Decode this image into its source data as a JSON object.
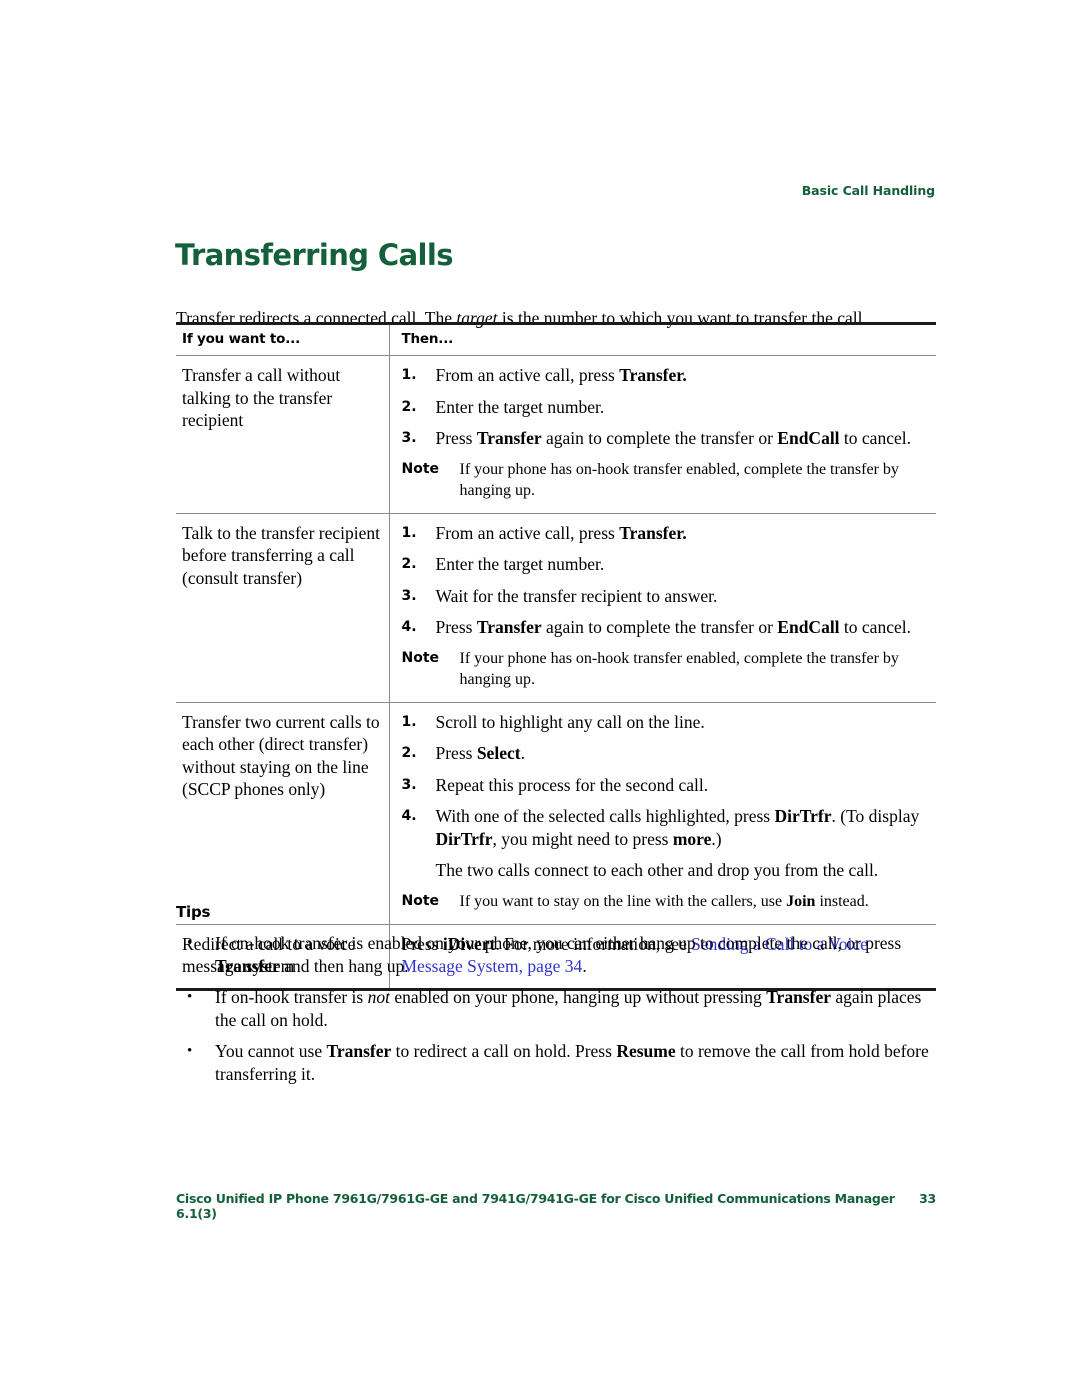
{
  "colors": {
    "heading_green": "#14603a",
    "link_blue": "#3333cc",
    "rule_dark": "#1a1a1a",
    "rule_light": "#8a8a8a"
  },
  "running_header": "Basic Call Handling",
  "page_title": "Transferring Calls",
  "intro": {
    "before_italic": "Transfer redirects a connected call. The ",
    "italic": "target",
    "after_italic": " is the number to which you want to transfer the call."
  },
  "table": {
    "headers": {
      "col1": "If you want to...",
      "col2": "Then..."
    },
    "rows": [
      {
        "label": "Transfer a call without talking to the transfer recipient",
        "steps": [
          {
            "num": "1.",
            "parts": [
              {
                "t": "From an active call, press ",
                "b": false
              },
              {
                "t": "Transfer.",
                "b": true
              }
            ]
          },
          {
            "num": "2.",
            "parts": [
              {
                "t": "Enter the target number.",
                "b": false
              }
            ]
          },
          {
            "num": "3.",
            "parts": [
              {
                "t": "Press ",
                "b": false
              },
              {
                "t": "Transfer",
                "b": true
              },
              {
                "t": " again to complete the transfer or ",
                "b": false
              },
              {
                "t": "EndCall",
                "b": true
              },
              {
                "t": " to cancel.",
                "b": false
              }
            ]
          }
        ],
        "note": {
          "label": "Note",
          "text": "If your phone has on-hook transfer enabled, complete the transfer by hanging up."
        }
      },
      {
        "label": "Talk to the transfer recipient before transferring a call (consult transfer)",
        "steps": [
          {
            "num": "1.",
            "parts": [
              {
                "t": "From an active call, press ",
                "b": false
              },
              {
                "t": "Transfer.",
                "b": true
              }
            ]
          },
          {
            "num": "2.",
            "parts": [
              {
                "t": "Enter the target number.",
                "b": false
              }
            ]
          },
          {
            "num": "3.",
            "parts": [
              {
                "t": "Wait for the transfer recipient to answer.",
                "b": false
              }
            ]
          },
          {
            "num": "4.",
            "parts": [
              {
                "t": "Press ",
                "b": false
              },
              {
                "t": "Transfer",
                "b": true
              },
              {
                "t": " again to complete the transfer or ",
                "b": false
              },
              {
                "t": "EndCall",
                "b": true
              },
              {
                "t": " to cancel.",
                "b": false
              }
            ]
          }
        ],
        "note": {
          "label": "Note",
          "text": "If your phone has on-hook transfer enabled, complete the transfer by hanging up."
        }
      },
      {
        "label": "Transfer two current calls to each other (direct transfer) without staying on the line (SCCP phones only)",
        "steps": [
          {
            "num": "1.",
            "parts": [
              {
                "t": "Scroll to highlight any call on the line.",
                "b": false
              }
            ]
          },
          {
            "num": "2.",
            "parts": [
              {
                "t": "Press ",
                "b": false
              },
              {
                "t": "Select",
                "b": true
              },
              {
                "t": ".",
                "b": false
              }
            ]
          },
          {
            "num": "3.",
            "parts": [
              {
                "t": "Repeat this process for the second call.",
                "b": false
              }
            ]
          },
          {
            "num": "4.",
            "parts": [
              {
                "t": "With one of the selected calls highlighted, press ",
                "b": false
              },
              {
                "t": "DirTrfr",
                "b": true
              },
              {
                "t": ". (To display ",
                "b": false
              },
              {
                "t": "DirTrfr",
                "b": true
              },
              {
                "t": ", you might need to press ",
                "b": false
              },
              {
                "t": "more",
                "b": true
              },
              {
                "t": ".)",
                "b": false
              }
            ]
          }
        ],
        "extra_para": "The two calls connect to each other and drop you from the call.",
        "note": {
          "label": "Note",
          "parts": [
            {
              "t": "If you want to stay on the line with the callers, use ",
              "b": false
            },
            {
              "t": "Join",
              "b": true
            },
            {
              "t": " instead.",
              "b": false
            }
          ]
        }
      },
      {
        "label": "Redirect a call to a voice message system",
        "paragraph_parts": [
          {
            "t": "Press ",
            "b": false,
            "link": false
          },
          {
            "t": "iDivert",
            "b": true,
            "link": false
          },
          {
            "t": ". For more information, see ",
            "b": false,
            "link": false
          },
          {
            "t": "Sending a Call to a Voice Message System, page 34",
            "b": false,
            "link": true
          },
          {
            "t": ".",
            "b": false,
            "link": false
          }
        ]
      }
    ]
  },
  "tips": {
    "heading": "Tips",
    "bullet_glyph": "•",
    "items": [
      {
        "parts": [
          {
            "t": "If on-hook transfer is enabled on your phone, you can either hang up to complete the call, or press ",
            "b": false
          },
          {
            "t": "Transfer",
            "b": true
          },
          {
            "t": " and then hang up.",
            "b": false
          }
        ]
      },
      {
        "parts": [
          {
            "t": "If on-hook transfer is ",
            "b": false
          },
          {
            "t": "not",
            "i": true
          },
          {
            "t": " enabled on your phone, hanging up without pressing ",
            "b": false
          },
          {
            "t": "Transfer",
            "b": true
          },
          {
            "t": " again places the call on hold.",
            "b": false
          }
        ]
      },
      {
        "parts": [
          {
            "t": "You cannot use ",
            "b": false
          },
          {
            "t": "Transfer",
            "b": true
          },
          {
            "t": " to redirect a call on hold. Press ",
            "b": false
          },
          {
            "t": "Resume",
            "b": true
          },
          {
            "t": " to remove the call from hold before transferring it.",
            "b": false
          }
        ]
      }
    ]
  },
  "footer": {
    "text": "Cisco Unified IP Phone 7961G/7961G-GE and 7941G/7941G-GE for Cisco Unified Communications Manager 6.1(3)",
    "page_number": "33"
  }
}
